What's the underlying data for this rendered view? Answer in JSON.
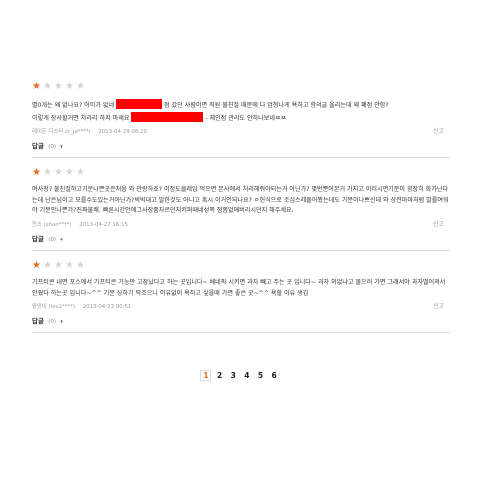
{
  "reviews": [
    {
      "stars": 1,
      "line1_a": "별0개는 왜 없나요? 어이가 없네",
      "line1_b": "점 갔던 사람이면 직원 불친절 때문에 다 엄청나게 욕하고 항의글 올리는데 왜 폐점 안함?",
      "line2_a": "이렇게 장사할거면 차라리 하지 마세요",
      "line2_b": "- 체인점 관리도 안하나보네ㅉㅉ",
      "author": "레이든 디스터 (c_ja****)",
      "date": "2013-04-29 08:29",
      "report": "신고",
      "reply_label": "답글",
      "reply_count": "(0)",
      "caret": "▾"
    },
    {
      "stars": 1,
      "text": "여사장? 불친절하고기분나쁜곳은처음 와 만랑하죠? 이정도클레임 먹으면 본사에서 처리해줘야되는거 아닌가? 몇번뿐어본거 가지고 이러시면기분이 굉장히 화가난다는데 난은님이고 모를수도있는거아닌가?빅빅대고 말한것도 아니고 혹시 이거안되나요? ㅇ헌식으로 조심스레물어봤는데도 기분이나쁘신데 와 상전마마처럼 말를여워야 기분안나쁜가?진짜불쾌. 빠른시간안에그사장좀자르던지키퍼때네성쪽 점쫌없애버리시던지 해주세요.",
      "author": "전스 (shan****)",
      "date": "2013-04-27 16:15",
      "report": "신고",
      "reply_label": "답글",
      "reply_count": "(0)",
      "caret": "▾"
    },
    {
      "stars": 1,
      "text": "기프티콘 내면 포스에서 기프티콘 기능만 고장났다고 하는 곳입니다~ 베네픽 시키면 과자 빼고 주는 곳 입니다~ 과자 와없냐고 물으러 가면 그래서야 과자떨어져서 안줬다 하는곳 입니다~^^ 기분 상하기 딱조으니 이유없이 욕하고 싶을때 가면 좋은 곳~^^ 욕할 이유 생김",
      "author": "왕망이 (lov2****)",
      "date": "2013-04-23 00:51",
      "report": "신고",
      "reply_label": "답글",
      "reply_count": "(0)",
      "caret": "▾"
    }
  ],
  "star_glyph": "★",
  "pagination": {
    "pages": [
      "1",
      "2",
      "3",
      "4",
      "5",
      "6"
    ],
    "current": "1"
  },
  "colors": {
    "accent": "#e86a1f",
    "redaction": "#ff0000"
  }
}
